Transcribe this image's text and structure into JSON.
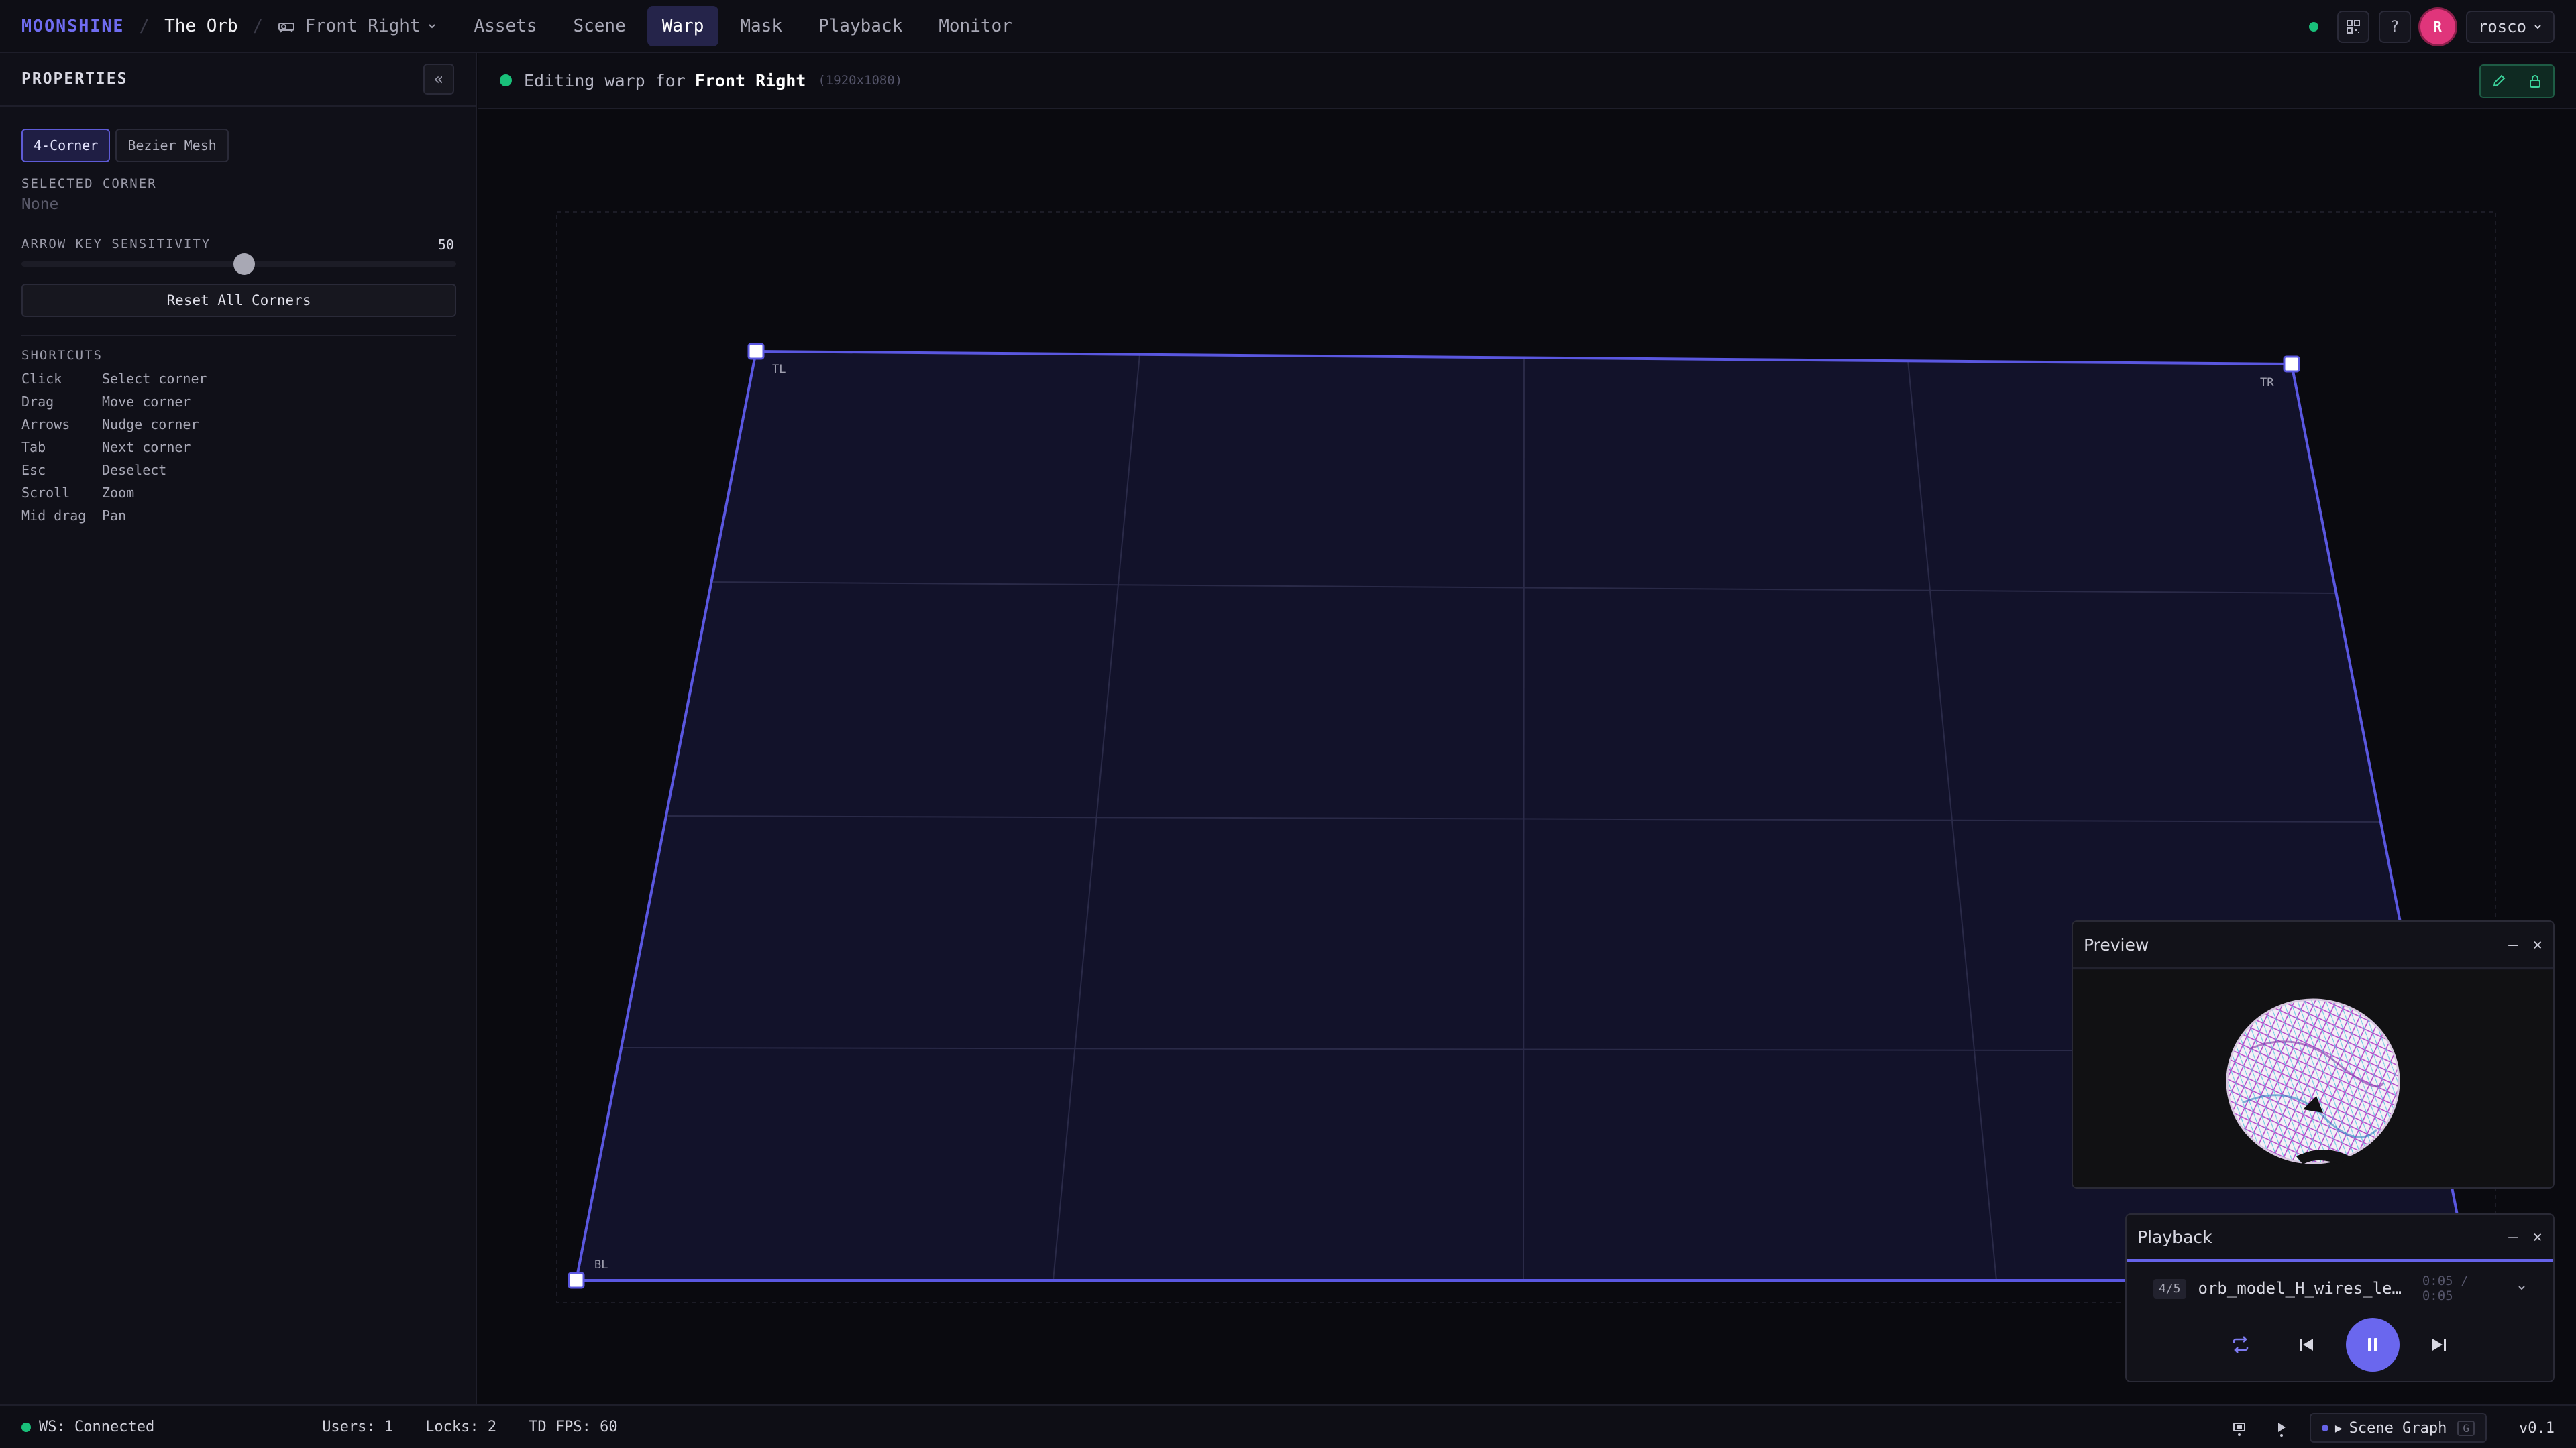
{
  "header": {
    "brand": "MOONSHINE",
    "separator": "/",
    "project": "The Orb",
    "output": "Front Right",
    "tabs": [
      {
        "label": "Assets"
      },
      {
        "label": "Scene"
      },
      {
        "label": "Warp"
      },
      {
        "label": "Mask"
      },
      {
        "label": "Playback"
      },
      {
        "label": "Monitor"
      }
    ],
    "active_tab": "Warp",
    "help_label": "?",
    "avatar_initial": "R",
    "user": "rosco"
  },
  "properties": {
    "title": "PROPERTIES",
    "collapse_label": "«",
    "modes": [
      "4-Corner",
      "Bezier Mesh"
    ],
    "active_mode": "4-Corner",
    "selected_corner_label": "SELECTED CORNER",
    "selected_corner_value": "None",
    "sensitivity_label": "ARROW KEY SENSITIVITY",
    "sensitivity_value": "50",
    "sensitivity_fraction": 0.5,
    "reset_label": "Reset All Corners",
    "shortcuts_title": "SHORTCUTS",
    "shortcuts": [
      {
        "key": "Click",
        "desc": "Select corner"
      },
      {
        "key": "Drag",
        "desc": "Move corner"
      },
      {
        "key": "Arrows",
        "desc": "Nudge corner"
      },
      {
        "key": "Tab",
        "desc": "Next corner"
      },
      {
        "key": "Esc",
        "desc": "Deselect"
      },
      {
        "key": "Scroll",
        "desc": "Zoom"
      },
      {
        "key": "Mid drag",
        "desc": "Pan"
      }
    ]
  },
  "editor": {
    "status_prefix": "Editing warp for",
    "output_name": "Front Right",
    "resolution": "(1920x1080)",
    "corner_labels": {
      "tl": "TL",
      "tr": "TR",
      "bl": "BL"
    }
  },
  "preview": {
    "title": "Preview",
    "minimize": "–",
    "close": "×"
  },
  "playback": {
    "title": "Playback",
    "minimize": "–",
    "close": "×",
    "position": "4/5",
    "file": "orb_model_H_wires_le…",
    "time": "0:05 / 0:05"
  },
  "status": {
    "ws": "WS: Connected",
    "users": "Users: 1",
    "locks": "Locks: 2",
    "fps": "TD FPS: 60",
    "scene_graph": "Scene Graph",
    "scene_graph_badge": "G",
    "version": "v0.1"
  },
  "colors": {
    "accent": "#6663e8",
    "ok": "#19c07a",
    "avatar": "#e0357b"
  }
}
